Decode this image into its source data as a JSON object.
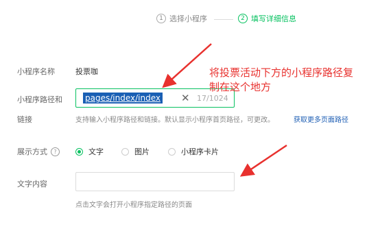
{
  "stepper": {
    "step1": {
      "number": "1",
      "label": "选择小程序"
    },
    "step2": {
      "number": "2",
      "label": "填写详细信息"
    }
  },
  "form": {
    "name": {
      "label": "小程序名称",
      "value": "投票咖"
    },
    "path": {
      "label_line1": "小程序路径和",
      "label_line2": "链接",
      "value": "pages/index/index",
      "clear_symbol": "✕",
      "counter": "17/1024",
      "hint": "支持输入小程序路径和链接。默认显示小程序首页路径，可更改。",
      "hint_link": "获取更多页面路径"
    },
    "display": {
      "label": "展示方式",
      "help_symbol": "?",
      "options": [
        "文字",
        "图片",
        "小程序卡片"
      ],
      "selected": "文字"
    },
    "text_content": {
      "label": "文字内容",
      "value": "",
      "hint": "点击文字会打开小程序指定路径的页面"
    }
  },
  "annotation": {
    "line1": "将投票活动下方的小程序路径复",
    "line2": "制在这个地方",
    "color": "#e8312e"
  },
  "colors": {
    "accent": "#07c160",
    "link": "#1f5fb4"
  }
}
